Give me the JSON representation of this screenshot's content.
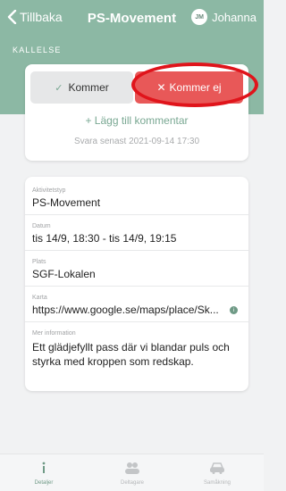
{
  "nav": {
    "back_label": "Tillbaka",
    "title": "PS-Movement",
    "user_initials": "JM",
    "user_name": "Johanna"
  },
  "section_label": "KALLELSE",
  "rsvp": {
    "going_label": "Kommer",
    "not_going_label": "Kommer ej",
    "selected": "not_going",
    "add_comment_label": "+ Lägg till kommentar",
    "deadline": "Svara senast 2021-09-14 17:30"
  },
  "details": {
    "activity_type_label": "Aktivitetstyp",
    "activity_type": "PS-Movement",
    "date_label": "Datum",
    "date": "tis 14/9, 18:30 - tis 14/9, 19:15",
    "place_label": "Plats",
    "place": "SGF-Lokalen",
    "map_label": "Karta",
    "map_url": "https://www.google.se/maps/place/Sk...",
    "more_info_label": "Mer information",
    "more_info": "Ett glädjefyllt pass där vi blandar puls och styrka med kroppen som redskap."
  },
  "tabs": [
    {
      "label": "Detaljer",
      "icon": "info-icon",
      "active": true
    },
    {
      "label": "Deltagare",
      "icon": "people-icon",
      "active": false
    },
    {
      "label": "Samåkning",
      "icon": "car-icon",
      "active": false
    }
  ],
  "colors": {
    "header": "#8cb8a4",
    "accent": "#7aa893",
    "declined": "#e85858",
    "annotation_ring": "#e0141b"
  }
}
